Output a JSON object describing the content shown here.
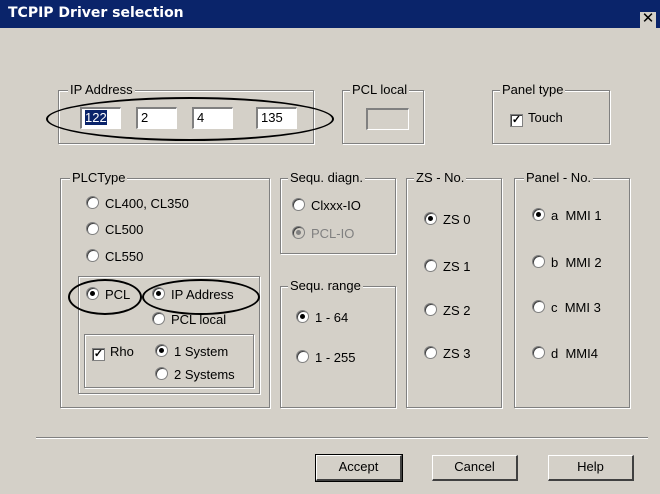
{
  "window": {
    "title": "TCPIP Driver selection",
    "close_glyph": "✕"
  },
  "ip_address": {
    "label": "IP Address",
    "octets": [
      "122",
      "2",
      "4",
      "135"
    ]
  },
  "pcl_local": {
    "label": "PCL local",
    "value": ""
  },
  "panel_type": {
    "label": "Panel type",
    "touch_label": "Touch",
    "touch_checked": true
  },
  "plc_type": {
    "label": "PLCType",
    "options": [
      "CL400, CL350",
      "CL500",
      "CL550",
      "PCL"
    ],
    "selected": "PCL",
    "pcl_sub": {
      "options": [
        "IP Address",
        "PCL local"
      ],
      "selected": "IP Address"
    },
    "rho": {
      "label": "Rho",
      "checked": true,
      "options": [
        "1 System",
        "2 Systems"
      ],
      "selected": "1 System"
    }
  },
  "sequ_diagn": {
    "label": "Sequ. diagn.",
    "options": [
      "Clxxx-IO",
      "PCL-IO"
    ],
    "selected": "PCL-IO"
  },
  "sequ_range": {
    "label": "Sequ. range",
    "options": [
      "1 - 64",
      "1 - 255"
    ],
    "selected": "1 - 64"
  },
  "zs_no": {
    "label": "ZS - No.",
    "options": [
      "ZS 0",
      "ZS 1",
      "ZS 2",
      "ZS 3"
    ],
    "selected": "ZS 0"
  },
  "panel_no": {
    "label": "Panel - No.",
    "options": [
      "a  MMI 1",
      "b  MMI 2",
      "c  MMI 3",
      "d  MMI4"
    ],
    "selected": "a  MMI 1"
  },
  "buttons": {
    "accept": "Accept",
    "cancel": "Cancel",
    "help": "Help"
  },
  "check_glyph": "✓"
}
